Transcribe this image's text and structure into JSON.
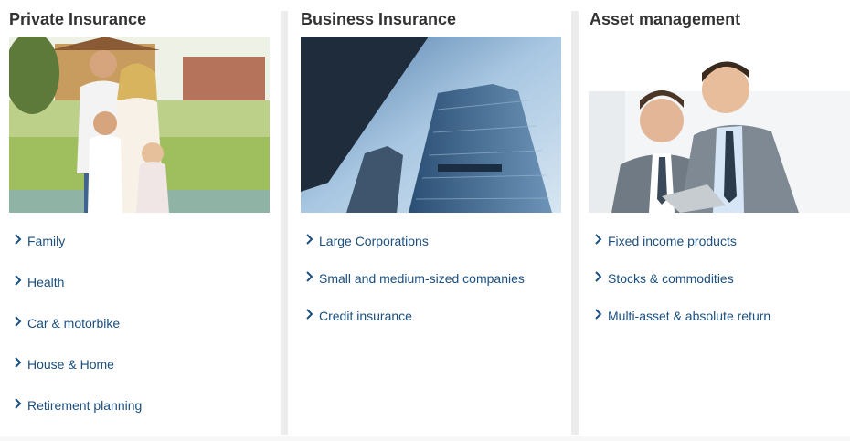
{
  "columns": [
    {
      "title": "Private Insurance",
      "image_alt": "Family of four in front of a house",
      "links": [
        "Family",
        "Health",
        "Car & motorbike",
        "House & Home",
        "Retirement planning"
      ]
    },
    {
      "title": "Business Insurance",
      "image_alt": "Office skyscrapers against blue sky",
      "links": [
        "Large Corporations",
        "Small and medium-sized companies",
        "Credit insurance"
      ]
    },
    {
      "title": "Asset management",
      "image_alt": "Two businessmen looking at a tablet",
      "links": [
        "Fixed income products",
        "Stocks & commodities",
        "Multi-asset & absolute return"
      ]
    }
  ],
  "colors": {
    "link": "#1b4f7f",
    "title": "#333333",
    "divider": "#ececec"
  },
  "icons": {
    "link_bullet": "chevron-right-icon"
  }
}
